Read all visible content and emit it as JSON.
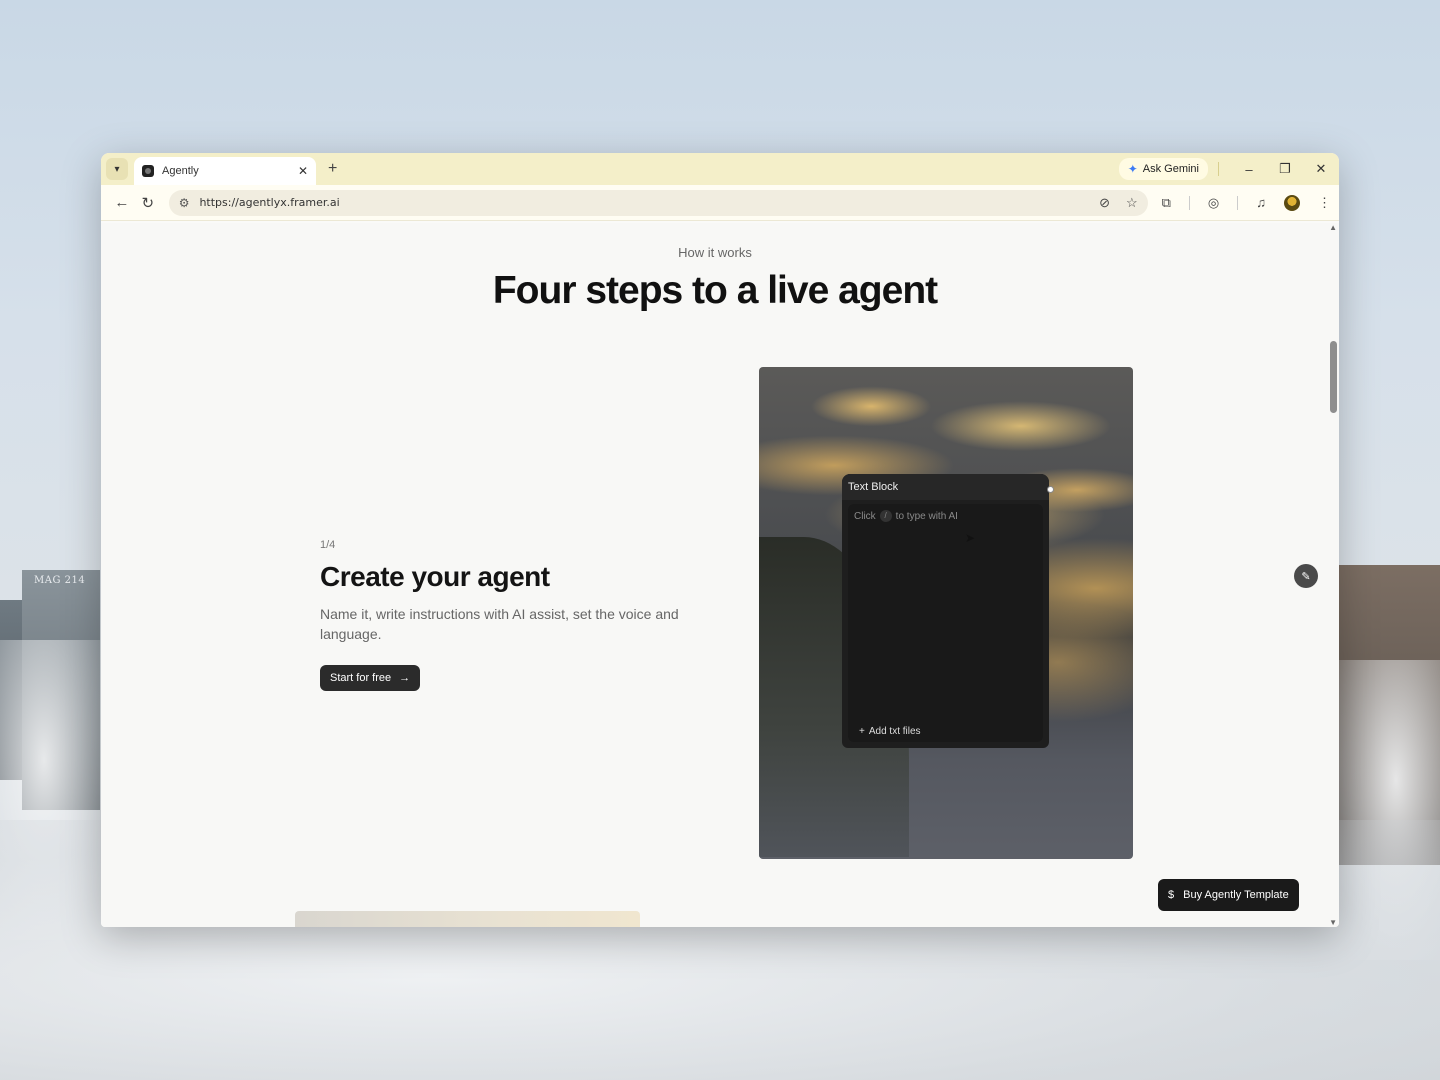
{
  "wallpaper": {
    "sign_text": "MAG 214"
  },
  "browser": {
    "tab_title": "Agently",
    "new_tab_icon": "+",
    "gemini_label": "Ask Gemini",
    "url": "https://agentlyx.framer.ai",
    "window_controls": {
      "minimize": "–",
      "restore": "❐",
      "close": "✕"
    },
    "icons": [
      "tab-list-icon",
      "close-icon",
      "back-icon",
      "reload-icon",
      "site-settings-icon",
      "eye-off-icon",
      "star-icon",
      "extensions-icon",
      "lens-icon",
      "media-icon",
      "avatar",
      "menu-icon"
    ]
  },
  "section": {
    "eyebrow": "How it works",
    "headline": "Four steps to a live agent"
  },
  "step": {
    "count": "1/4",
    "title": "Create your agent",
    "description": "Name it, write instructions with AI assist, set the voice and language.",
    "cta_label": "Start for free"
  },
  "text_block": {
    "header": "Text Block",
    "placeholder_prefix": "Click",
    "placeholder_key": "/",
    "placeholder_suffix": "to type with AI",
    "add_files_label": "Add txt files"
  },
  "buy_button": {
    "label": "Buy Agently Template"
  },
  "colors": {
    "tabbar": "#f4efc9",
    "cta": "#2b2b2b",
    "page_bg": "#f8f8f6",
    "text_block_bg": "#1e1e1e"
  }
}
